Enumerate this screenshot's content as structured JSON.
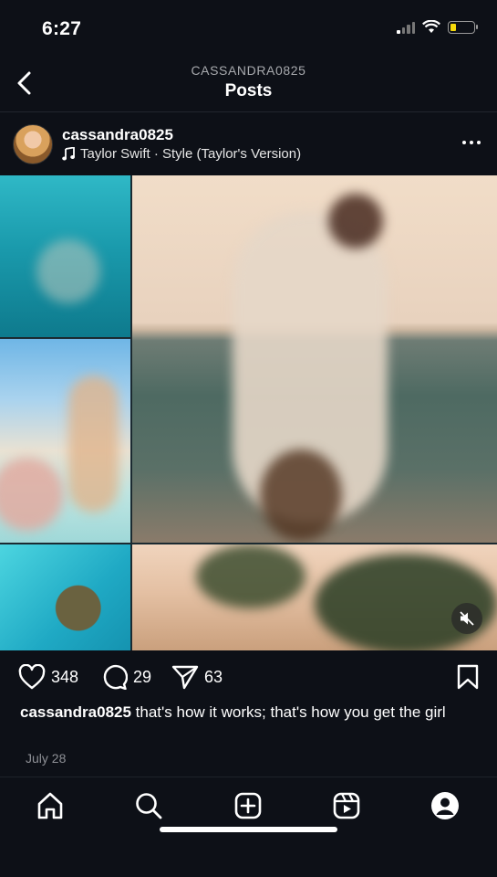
{
  "status": {
    "time": "6:27"
  },
  "header": {
    "subtitle": "CASSANDRA0825",
    "title": "Posts"
  },
  "post": {
    "username": "cassandra0825",
    "audio": "Taylor Swift · Style (Taylor's Version)",
    "likes": "348",
    "comments": "29",
    "shares": "63",
    "caption_user": "cassandra0825",
    "caption_text": "that's how it works; that's how you get the girl",
    "date": "July 28"
  },
  "icons": {
    "back": "chevron-left-icon",
    "more": "more-horizontal-icon",
    "music": "music-note-icon",
    "mute": "muted-speaker-icon",
    "like": "heart-icon",
    "comment": "comment-bubble-icon",
    "share": "paper-plane-icon",
    "save": "bookmark-icon"
  },
  "tabs": [
    {
      "label": "home",
      "icon": "home-icon"
    },
    {
      "label": "search",
      "icon": "search-icon"
    },
    {
      "label": "create",
      "icon": "plus-square-icon"
    },
    {
      "label": "reels",
      "icon": "reels-icon"
    },
    {
      "label": "profile",
      "icon": "profile-icon"
    }
  ],
  "colors": {
    "background": "#0d1017",
    "text": "#ffffff",
    "muted": "#a7a9ad",
    "battery": "#f5d90a"
  }
}
